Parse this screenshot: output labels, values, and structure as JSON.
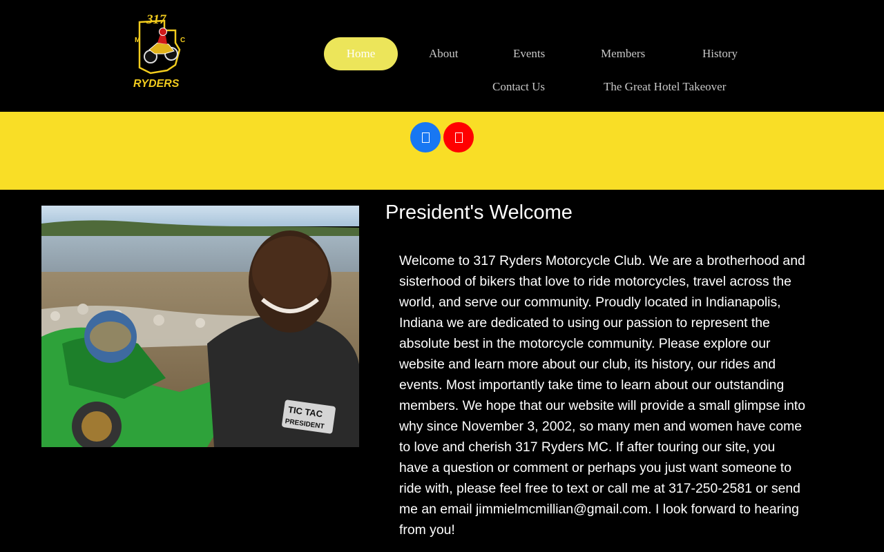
{
  "logo": {
    "number": "317",
    "letter_left": "M",
    "letter_right": "C",
    "name": "RYDERS"
  },
  "nav": {
    "items": [
      {
        "label": "Home",
        "active": true
      },
      {
        "label": "About"
      },
      {
        "label": "Events"
      },
      {
        "label": "Members"
      },
      {
        "label": "History"
      },
      {
        "label": "Contact Us"
      },
      {
        "label": "The Great Hotel Takeover"
      }
    ]
  },
  "social": [
    {
      "icon": "facebook-icon",
      "color": "#1877f2"
    },
    {
      "icon": "youtube-icon",
      "color": "#ff0000"
    }
  ],
  "photo": {
    "patch_top": "TIC TAC",
    "patch_bottom": "PRESIDENT"
  },
  "welcome": {
    "title": "President's Welcome",
    "body": "Welcome to 317 Ryders Motorcycle Club. We are a brotherhood and sisterhood of bikers that love to ride motorcycles, travel across the world, and serve our community. Proudly located in Indianapolis, Indiana we are dedicated to using our passion to represent the absolute best in the motorcycle community. Please explore our website and learn more about our club, its history, our rides and events. Most importantly take time to learn about our outstanding members. We hope that our website will provide a small glimpse into why since November 3, 2002, so many men and women have come to love and cherish 317 Ryders MC. If after touring our site, you have a question or comment or perhaps you just want someone to ride with, please feel free to text or call me at 317-250-2581 or send me an email jimmielmcmillian@gmail.com. I look forward to hearing from you!"
  },
  "colors": {
    "accent_yellow": "#f9de26",
    "nav_active": "#ece55a",
    "background": "#000000"
  }
}
